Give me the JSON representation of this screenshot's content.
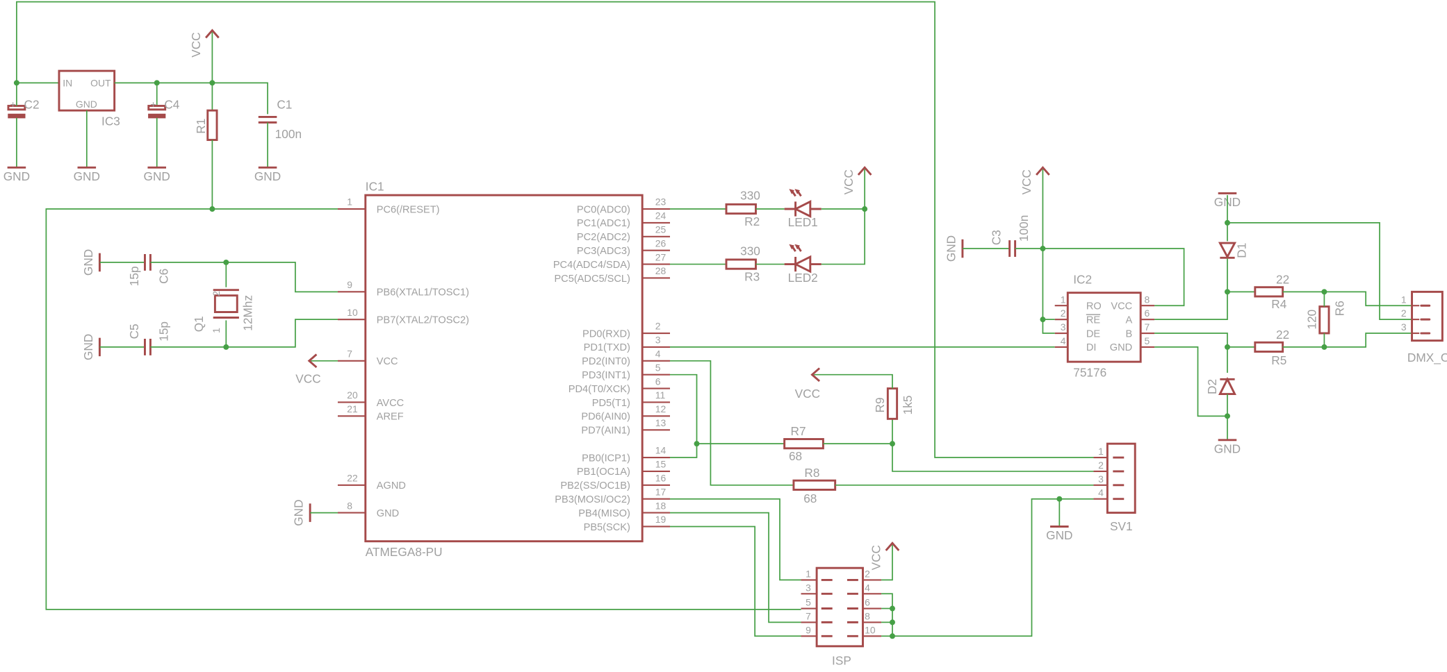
{
  "colors": {
    "wire": "#46a046",
    "symbol": "#a54a4a",
    "text": "#a0a0a0",
    "background": "#ffffff"
  },
  "supply": {
    "vcc": "VCC",
    "gnd": "GND"
  },
  "ic1": {
    "name": "IC1",
    "value": "ATMEGA8-PU",
    "left_pins": [
      {
        "num": "1",
        "label": "PC6(/RESET)"
      },
      {
        "num": "9",
        "label": "PB6(XTAL1/TOSC1)"
      },
      {
        "num": "10",
        "label": "PB7(XTAL2/TOSC2)"
      },
      {
        "num": "7",
        "label": "VCC"
      },
      {
        "num": "20",
        "label": "AVCC"
      },
      {
        "num": "21",
        "label": "AREF"
      },
      {
        "num": "22",
        "label": "AGND"
      },
      {
        "num": "8",
        "label": "GND"
      }
    ],
    "right_pins": [
      {
        "num": "23",
        "label": "PC0(ADC0)"
      },
      {
        "num": "24",
        "label": "PC1(ADC1)"
      },
      {
        "num": "25",
        "label": "PC2(ADC2)"
      },
      {
        "num": "26",
        "label": "PC3(ADC3)"
      },
      {
        "num": "27",
        "label": "PC4(ADC4/SDA)"
      },
      {
        "num": "28",
        "label": "PC5(ADC5/SCL)"
      },
      {
        "num": "2",
        "label": "PD0(RXD)"
      },
      {
        "num": "3",
        "label": "PD1(TXD)"
      },
      {
        "num": "4",
        "label": "PD2(INT0)"
      },
      {
        "num": "5",
        "label": "PD3(INT1)"
      },
      {
        "num": "6",
        "label": "PD4(T0/XCK)"
      },
      {
        "num": "11",
        "label": "PD5(T1)"
      },
      {
        "num": "12",
        "label": "PD6(AIN0)"
      },
      {
        "num": "13",
        "label": "PD7(AIN1)"
      },
      {
        "num": "14",
        "label": "PB0(ICP1)"
      },
      {
        "num": "15",
        "label": "PB1(OC1A)"
      },
      {
        "num": "16",
        "label": "PB2(SS/OC1B)"
      },
      {
        "num": "17",
        "label": "PB3(MOSI/OC2)"
      },
      {
        "num": "18",
        "label": "PB4(MISO)"
      },
      {
        "num": "19",
        "label": "PB5(SCK)"
      }
    ]
  },
  "ic2": {
    "name": "IC2",
    "value": "75176",
    "left_pins": [
      {
        "num": "1",
        "label": "RO"
      },
      {
        "num": "2",
        "label": "RE"
      },
      {
        "num": "3",
        "label": "DE"
      },
      {
        "num": "4",
        "label": "DI"
      }
    ],
    "right_pins": [
      {
        "num": "8",
        "label": "VCC"
      },
      {
        "num": "6",
        "label": "A"
      },
      {
        "num": "7",
        "label": "B"
      },
      {
        "num": "5",
        "label": "GND"
      }
    ]
  },
  "ic3": {
    "name": "IC3",
    "pin_in": "IN",
    "pin_out": "OUT",
    "pin_gnd": "GND"
  },
  "capacitors": {
    "c1": {
      "name": "C1",
      "value": "100n"
    },
    "c2": {
      "name": "C2",
      "polarity": "+"
    },
    "c3": {
      "name": "C3",
      "value": "100n"
    },
    "c4": {
      "name": "C4",
      "polarity": "+"
    },
    "c5": {
      "name": "C5",
      "value": "15p"
    },
    "c6": {
      "name": "C6",
      "value": "15p"
    }
  },
  "resistors": {
    "r1": {
      "name": "R1"
    },
    "r2": {
      "name": "R2",
      "value": "330"
    },
    "r3": {
      "name": "R3",
      "value": "330"
    },
    "r4": {
      "name": "R4",
      "value": "22"
    },
    "r5": {
      "name": "R5",
      "value": "22"
    },
    "r6": {
      "name": "R6",
      "value": "120"
    },
    "r7": {
      "name": "R7",
      "value": "68"
    },
    "r8": {
      "name": "R8",
      "value": "68"
    },
    "r9": {
      "name": "R9",
      "value": "1k5"
    }
  },
  "leds": {
    "led1": {
      "name": "LED1"
    },
    "led2": {
      "name": "LED2"
    }
  },
  "diodes": {
    "d1": {
      "name": "D1"
    },
    "d2": {
      "name": "D2"
    }
  },
  "crystal": {
    "name": "Q1",
    "value": "12Mhz",
    "pin1": "1",
    "pin2": "2"
  },
  "connectors": {
    "sv1": {
      "name": "SV1",
      "pins": [
        "1",
        "2",
        "3",
        "4"
      ]
    },
    "isp": {
      "name": "ISP",
      "pins": [
        "1",
        "2",
        "3",
        "4",
        "5",
        "6",
        "7",
        "8",
        "9",
        "10"
      ]
    },
    "dmx": {
      "name": "DMX_OUT",
      "pins": [
        "1",
        "2",
        "3"
      ]
    }
  }
}
